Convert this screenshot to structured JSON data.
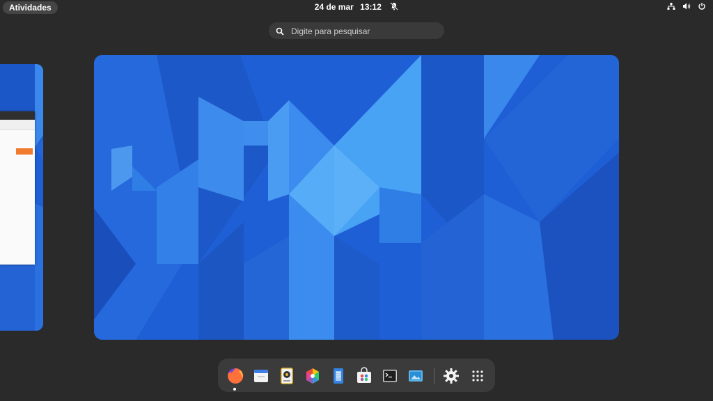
{
  "topbar": {
    "activities_label": "Atividades",
    "date": "24 de mar",
    "time": "13:12",
    "tray_icons": [
      "network-icon",
      "volume-icon",
      "power-icon"
    ]
  },
  "search": {
    "placeholder": "Digite para pesquisar"
  },
  "dock": {
    "apps": [
      "firefox",
      "calendar",
      "rhythmbox",
      "photos",
      "text-editor",
      "software",
      "terminal",
      "screenshot",
      "settings",
      "show-apps"
    ],
    "running": [
      "firefox"
    ]
  },
  "colors": {
    "background": "#2a2a2a",
    "wallpaper": "#1f5fd6",
    "dock": "#3b3b3b",
    "accent_orange": "#f07b2f"
  }
}
